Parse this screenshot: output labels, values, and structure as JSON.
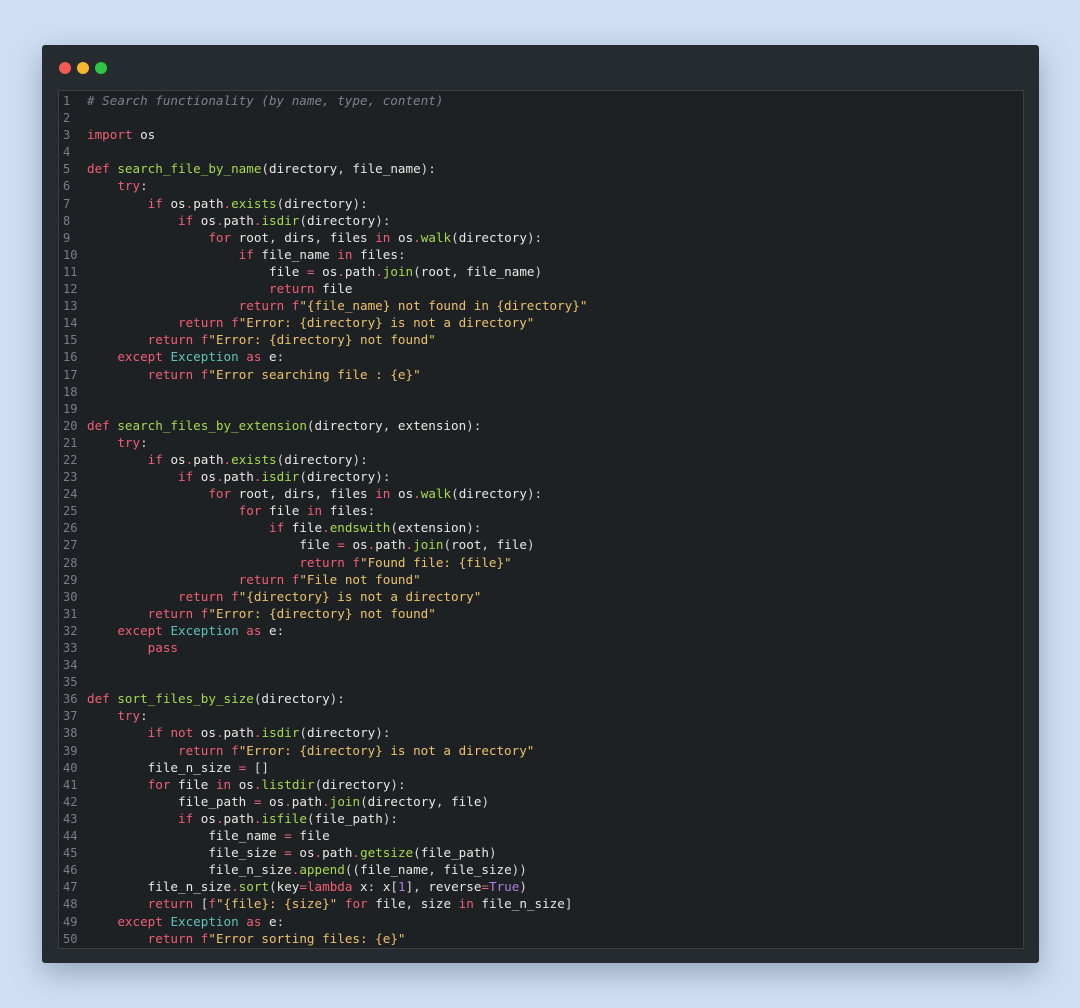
{
  "window": {
    "controls": [
      "close",
      "minimize",
      "maximize"
    ],
    "colors": {
      "close": "#f25a53",
      "minimize": "#f5b82e",
      "maximize": "#2fc442"
    }
  },
  "editor": {
    "language": "python",
    "lines": [
      "# Search functionality (by name, type, content)",
      "",
      "import os",
      "",
      "def search_file_by_name(directory, file_name):",
      "    try:",
      "        if os.path.exists(directory):",
      "            if os.path.isdir(directory):",
      "                for root, dirs, files in os.walk(directory):",
      "                    if file_name in files:",
      "                        file = os.path.join(root, file_name)",
      "                        return file",
      "                    return f\"{file_name} not found in {directory}\"",
      "            return f\"Error: {directory} is not a directory\"",
      "        return f\"Error: {directory} not found\"",
      "    except Exception as e:",
      "        return f\"Error searching file : {e}\"",
      "",
      "",
      "def search_files_by_extension(directory, extension):",
      "    try:",
      "        if os.path.exists(directory):",
      "            if os.path.isdir(directory):",
      "                for root, dirs, files in os.walk(directory):",
      "                    for file in files:",
      "                        if file.endswith(extension):",
      "                            file = os.path.join(root, file)",
      "                            return f\"Found file: {file}\"",
      "                    return f\"File not found\"",
      "            return f\"{directory} is not a directory\"",
      "        return f\"Error: {directory} not found\"",
      "    except Exception as e:",
      "        pass",
      "",
      "",
      "def sort_files_by_size(directory):",
      "    try:",
      "        if not os.path.isdir(directory):",
      "            return f\"Error: {directory} is not a directory\"",
      "        file_n_size = []",
      "        for file in os.listdir(directory):",
      "            file_path = os.path.join(directory, file)",
      "            if os.path.isfile(file_path):",
      "                file_name = file",
      "                file_size = os.path.getsize(file_path)",
      "                file_n_size.append((file_name, file_size))",
      "        file_n_size.sort(key=lambda x: x[1], reverse=True)",
      "        return [f\"{file}: {size}\" for file, size in file_n_size]",
      "    except Exception as e:",
      "        return f\"Error sorting files: {e}\""
    ]
  }
}
